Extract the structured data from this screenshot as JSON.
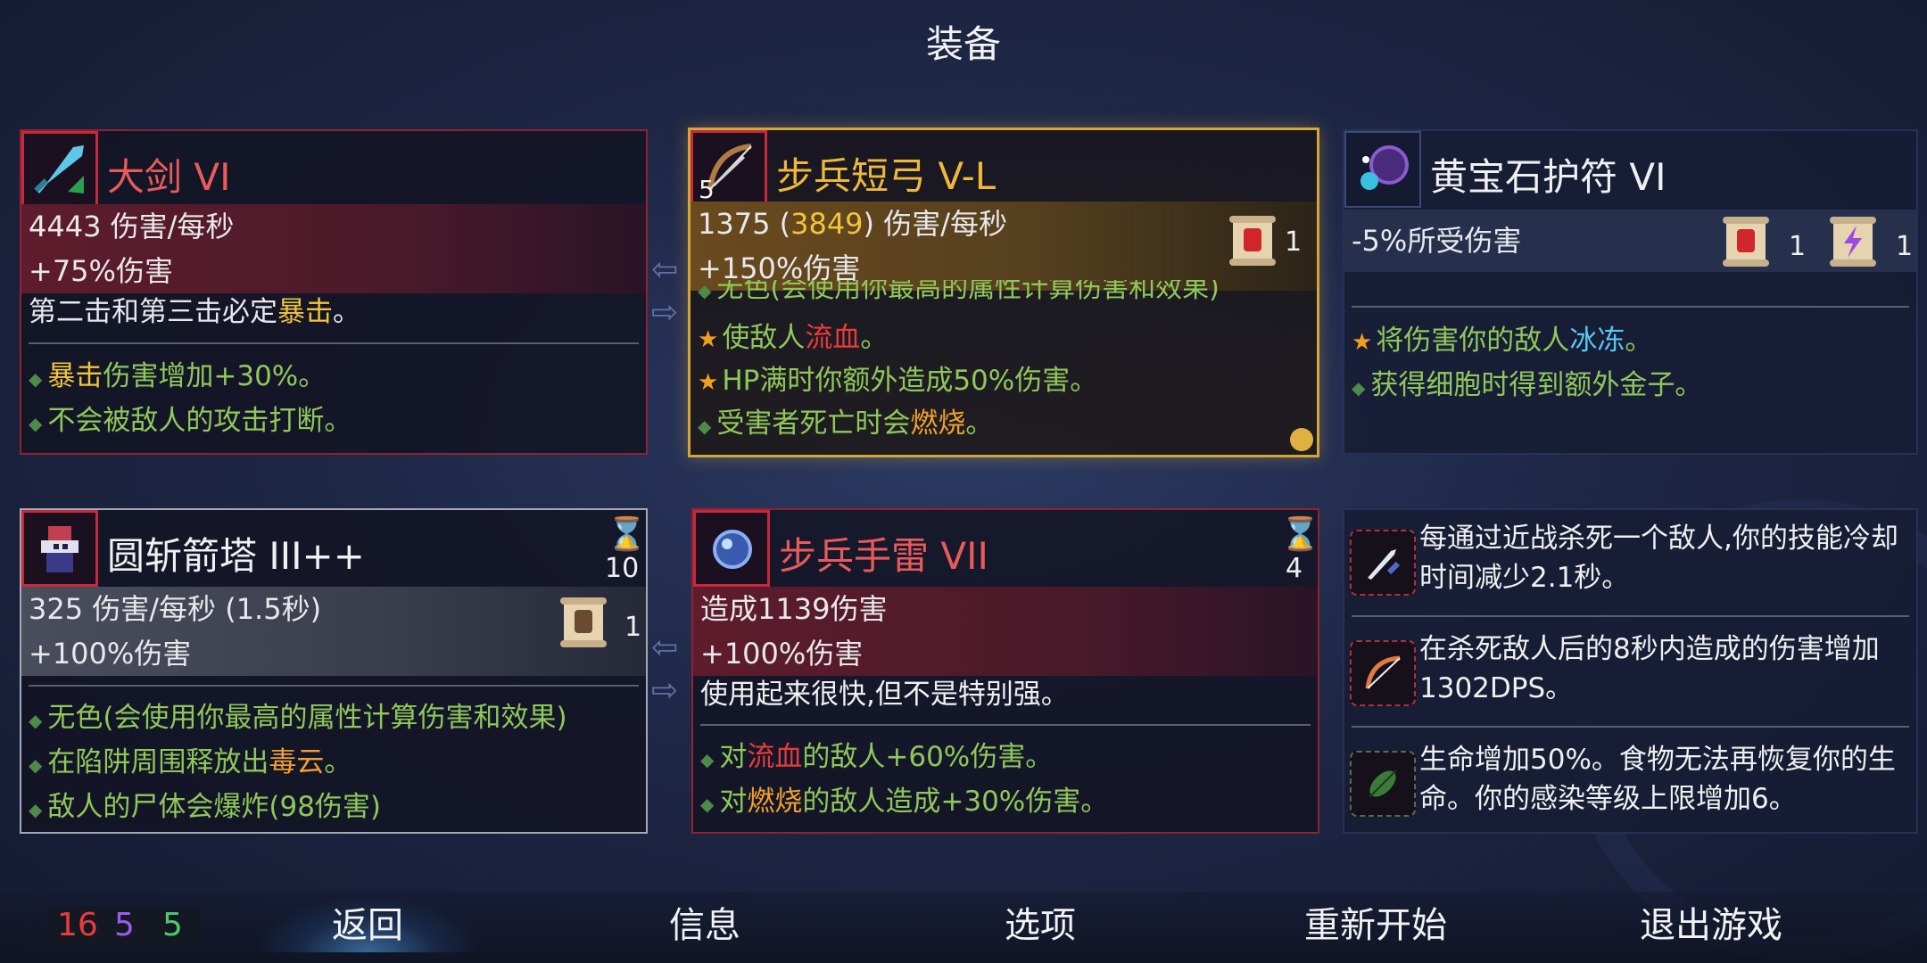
{
  "title": "装备",
  "cards": {
    "greatsword": {
      "name": "大剑 VI",
      "stat1": "4443 伤害/每秒",
      "stat2": "+75%伤害",
      "desc_a": "第二击和第三击必定",
      "desc_crit": "暴击",
      "desc_end": "。",
      "p1_crit": "暴击",
      "p1_rest": "伤害增加+30%。",
      "p2": "不会被敌人的攻击打断。",
      "icon": "sword-icon"
    },
    "bow": {
      "name": "步兵短弓 V-L",
      "icon_level": "5",
      "stat1_a": "1375 (",
      "stat1_b": "3849",
      "stat1_c": ") 伤害/每秒",
      "stat2": "+150%伤害",
      "scroll_count": "1",
      "cut_line": "无色(会使用你最高的属性计算伤害和效果)",
      "l1_a": "使敌人",
      "l1_b": "流血",
      "l1_c": "。",
      "l2": "HP满时你额外造成50%伤害。",
      "l3_a": "受害者死亡时会",
      "l3_b": "燃烧",
      "l3_c": "。",
      "icon": "bow-icon"
    },
    "amulet": {
      "name": "黄宝石护符 VI",
      "stat": "-5%所受伤害",
      "scroll1_count": "1",
      "scroll2_count": "1",
      "l1_a": "将伤害你的敌人",
      "l1_b": "冰冻",
      "l1_c": "。",
      "l2": "获得细胞时得到额外金子。",
      "icon": "amulet-icon"
    },
    "turret": {
      "name": "圆斩箭塔 III++",
      "cooldown": "10",
      "stat1": "325 伤害/每秒 (1.5秒)",
      "stat2": "+100%伤害",
      "scroll_count": "1",
      "l1": "无色(会使用你最高的属性计算伤害和效果)",
      "l2_a": "在陷阱周围释放出",
      "l2_b": "毒云",
      "l2_c": "。",
      "l3": "敌人的尸体会爆炸(98伤害)",
      "icon": "turret-icon"
    },
    "grenade": {
      "name": "步兵手雷 VII",
      "cooldown": "4",
      "stat1": "造成1139伤害",
      "stat2": "+100%伤害",
      "desc": "使用起来很快,但不是特别强。",
      "l1_a": "对",
      "l1_b": "流血",
      "l1_c": "的敌人+60%伤害。",
      "l2_a": "对",
      "l2_b": "燃烧",
      "l2_c": "的敌人造成+30%伤害。",
      "icon": "grenade-icon"
    }
  },
  "mutations": [
    {
      "text": "每通过近战杀死一个敌人,你的技能冷却时间减少2.1秒。",
      "icon": "dagger-mutation-icon"
    },
    {
      "text": "在杀死敌人后的8秒内造成的伤害增加1302DPS。",
      "icon": "bow-mutation-icon"
    },
    {
      "text": "生命增加50%。食物无法再恢复你的生命。你的感染等级上限增加6。",
      "icon": "leaf-mutation-icon"
    }
  ],
  "footer": {
    "count_red": "16",
    "count_purple": "5",
    "count_green": "5",
    "back": "返回",
    "info": "信息",
    "options": "选项",
    "restart": "重新开始",
    "quit": "退出游戏"
  },
  "colors": {
    "brutality": "#ea3b3b",
    "tactics": "#9a5cf0",
    "survival": "#4ec86a",
    "accent_gold": "#d4a537"
  }
}
